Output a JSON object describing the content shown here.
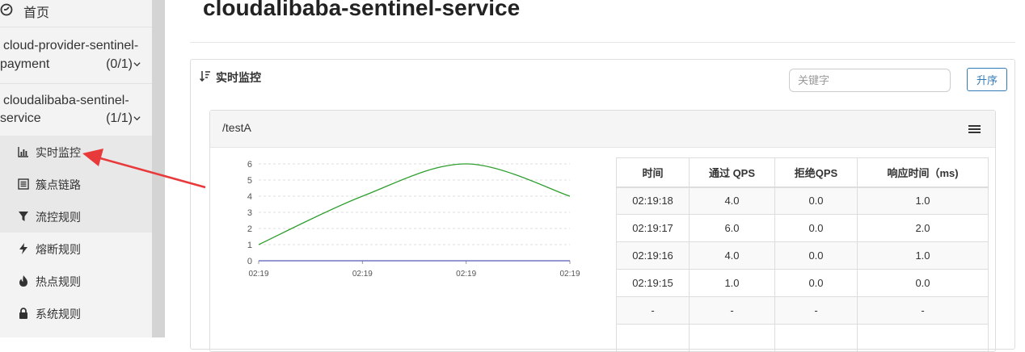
{
  "sidebar": {
    "home": {
      "label": "首页",
      "icon": "dashboard-icon"
    },
    "apps": [
      {
        "line1": "cloud-provider-sentinel-",
        "line2": "payment",
        "count": "(0/1)",
        "expanded": false
      },
      {
        "line1": "cloudalibaba-sentinel-",
        "line2": "service",
        "count": "(1/1)",
        "expanded": true
      }
    ],
    "menu": [
      {
        "label": "实时监控",
        "icon": "bar-chart-icon",
        "active": true
      },
      {
        "label": "簇点链路",
        "icon": "list-icon",
        "active": false
      },
      {
        "label": "流控规则",
        "icon": "filter-icon",
        "active": false
      },
      {
        "label": "熔断规则",
        "icon": "flash-icon",
        "active": false
      },
      {
        "label": "热点规则",
        "icon": "fire-icon",
        "active": false
      },
      {
        "label": "系统规则",
        "icon": "lock-icon",
        "active": false
      }
    ]
  },
  "page": {
    "title": "cloudalibaba-sentinel-service"
  },
  "panel": {
    "title": "实时监控",
    "search_placeholder": "关键字",
    "sort_label": "升序"
  },
  "resource": {
    "name": "/testA"
  },
  "colors": {
    "pass_line": "#2e9e2e",
    "block_line": "#5b5bb5",
    "accent": "#337ab7",
    "arrow": "#e8393b"
  },
  "chart_data": {
    "type": "line",
    "x": [
      "02:19",
      "02:19",
      "02:19",
      "02:19"
    ],
    "ylim": [
      0,
      6
    ],
    "yticks": [
      0,
      1,
      2,
      3,
      4,
      5,
      6
    ],
    "grid": true,
    "series": [
      {
        "values": [
          1.0,
          4.0,
          6.0,
          4.0
        ]
      },
      {
        "values": [
          0.0,
          0.0,
          0.0,
          0.0
        ]
      }
    ]
  },
  "table": {
    "headers": [
      "时间",
      "通过 QPS",
      "拒绝QPS",
      "响应时间（ms)"
    ],
    "rows": [
      [
        "02:19:18",
        "4.0",
        "0.0",
        "1.0"
      ],
      [
        "02:19:17",
        "6.0",
        "0.0",
        "2.0"
      ],
      [
        "02:19:16",
        "4.0",
        "0.0",
        "1.0"
      ],
      [
        "02:19:15",
        "1.0",
        "0.0",
        "0.0"
      ],
      [
        "-",
        "-",
        "-",
        "-"
      ],
      [
        "",
        "",
        "",
        ""
      ]
    ]
  }
}
